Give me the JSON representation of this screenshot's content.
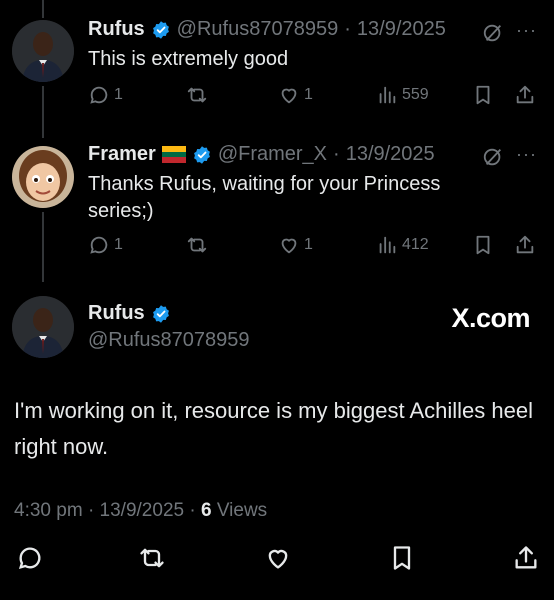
{
  "tweet1": {
    "name": "Rufus",
    "handle": "@Rufus87078959",
    "sep": "·",
    "date": "13/9/2025",
    "text": "This is extremely good",
    "replies": "1",
    "likes": "1",
    "views": "559"
  },
  "tweet2": {
    "name": "Framer",
    "flag": "lithuania-flag",
    "handle": "@Framer_X",
    "sep": "·",
    "date": "13/9/2025",
    "text": "Thanks Rufus, waiting for your Princess series;)",
    "replies": "1",
    "likes": "1",
    "views": "412"
  },
  "main": {
    "name": "Rufus",
    "handle": "@Rufus87078959",
    "brand": "X.com",
    "text": "I'm working on it, resource is my biggest Achilles heel right now.",
    "time": "4:30 pm",
    "sep1": "·",
    "date": "13/9/2025",
    "sep2": "·",
    "views_count": "6",
    "views_label": "Views"
  },
  "more_glyph": "···",
  "colors": {
    "background": "#000000",
    "text": "#e7e9ea",
    "muted": "#71767b",
    "verified": "#1d9bf0"
  }
}
